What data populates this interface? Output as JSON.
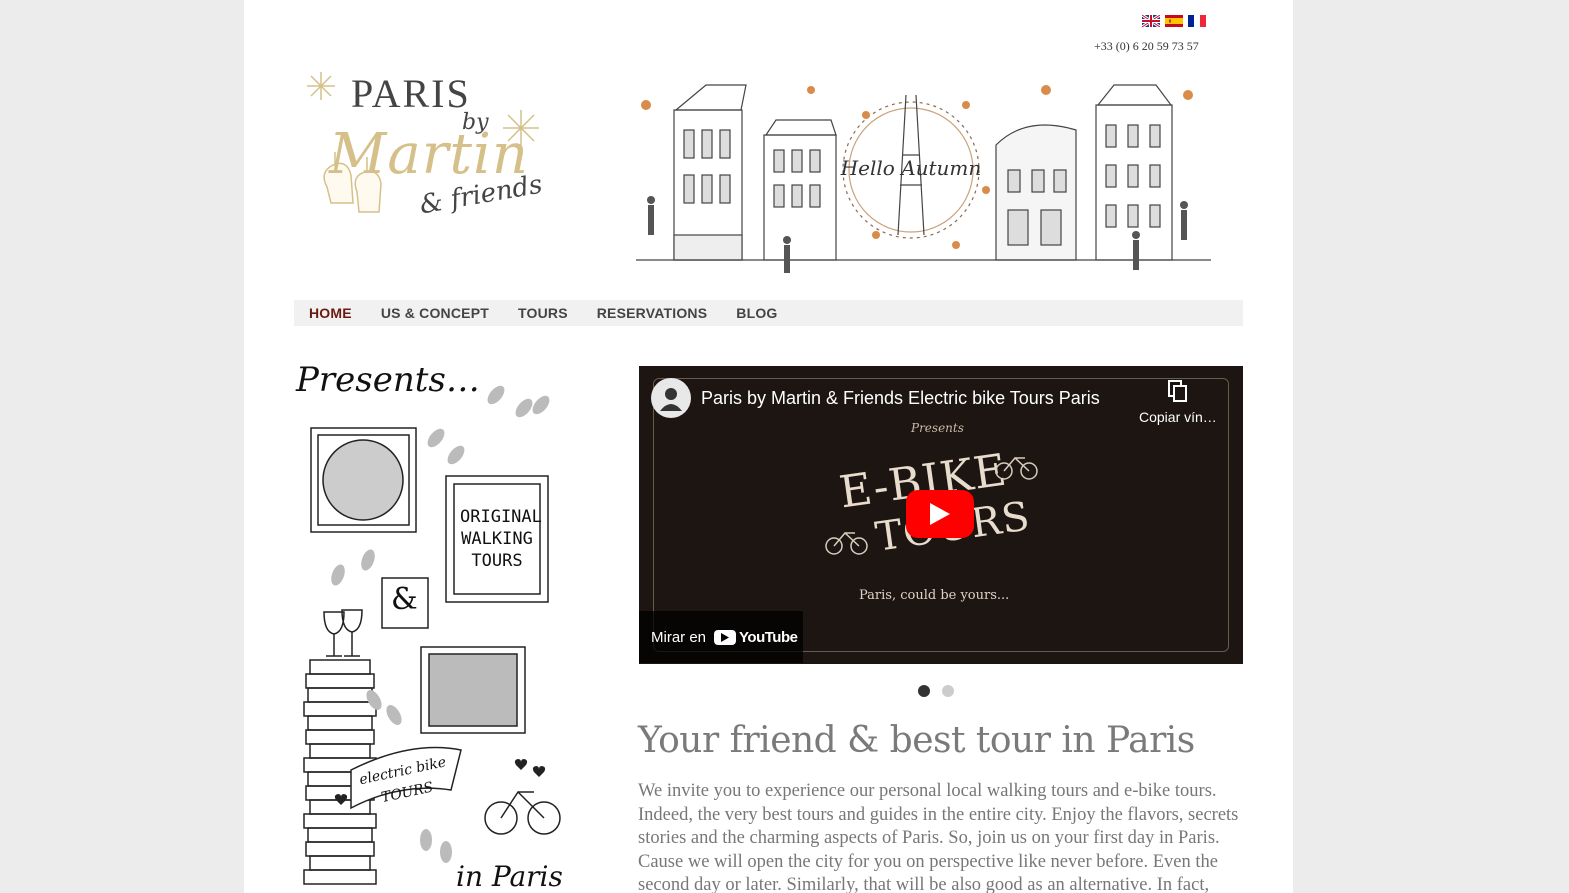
{
  "header": {
    "languages": [
      {
        "code": "en",
        "name": "English"
      },
      {
        "code": "es",
        "name": "Español"
      },
      {
        "code": "fr",
        "name": "Français"
      }
    ],
    "phone": "+33 (0) 6 20 59 73 57"
  },
  "logo": {
    "line1": "PARIS",
    "line2": "by",
    "line3": "Martin",
    "line4": "& friends"
  },
  "banner": {
    "text": "Hello Autumn"
  },
  "nav": {
    "items": [
      {
        "label": "HOME",
        "active": true
      },
      {
        "label": "US & CONCEPT",
        "active": false
      },
      {
        "label": "TOURS",
        "active": false
      },
      {
        "label": "RESERVATIONS",
        "active": false
      },
      {
        "label": "BLOG",
        "active": false
      }
    ]
  },
  "presents": {
    "title": "Presents…",
    "walking": "ORIGINAL WALKING TOURS",
    "amp": "&",
    "ebike": "electric bike TOURS",
    "footer": "in Paris"
  },
  "video": {
    "title": "Paris by Martin & Friends Electric bike Tours Paris",
    "copy_label": "Copiar vín…",
    "presents": "Presents",
    "ebike": "E-BIKE",
    "tours": "TOURS",
    "tagline": "Paris, could be yours...",
    "watch_label": "Mirar en",
    "brand": "YouTube"
  },
  "slider": {
    "count": 2,
    "active_index": 0
  },
  "content": {
    "headline": "Your friend & best tour in Paris",
    "intro": "We invite you to experience our personal local walking tours and e-bike tours. Indeed, the very best tours and guides in the entire city.  Enjoy the flavors, secrets stories and the charming aspects of Paris. So, join us on your first day in Paris. Cause we will open the city for you on perspective like never before. Even the second day or later. Similarly, that will be also good as an alternative. In fact,"
  },
  "colors": {
    "active_nav": "#6b1a12",
    "nav_bg": "#f1f1f1",
    "gold": "#d6c08a",
    "youtube_red": "#ff0000"
  }
}
